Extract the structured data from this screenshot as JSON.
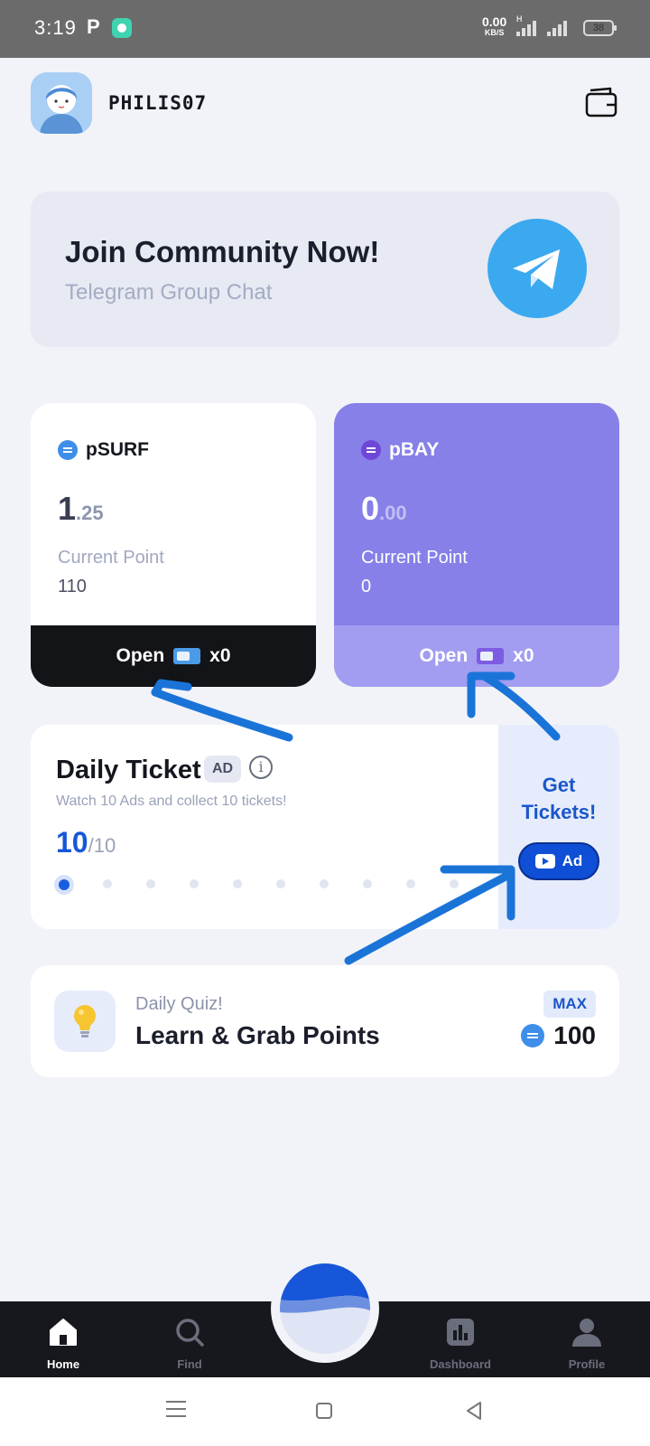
{
  "status_bar": {
    "time": "3:19",
    "notif_letter": "P",
    "net_speed": "0.00",
    "net_unit": "KB/S",
    "network_type": "H",
    "battery": "38"
  },
  "header": {
    "username": "PHILIS07",
    "avatar_icon": "user-avatar",
    "wallet_icon": "wallet-icon"
  },
  "community": {
    "title": "Join Community Now!",
    "subtitle": "Telegram Group Chat",
    "icon": "telegram-icon"
  },
  "cards": {
    "surf": {
      "token": "pSURF",
      "int_part": "1",
      "dec_part": ".25",
      "label": "Current Point",
      "value": "110",
      "open_label": "Open",
      "ticket_count": "x0",
      "color": "#3f8ee9"
    },
    "bay": {
      "token": "pBAY",
      "int_part": "0",
      "dec_part": ".00",
      "label": "Current Point",
      "value": "0",
      "open_label": "Open",
      "ticket_count": "x0",
      "color": "#7d5ce4"
    }
  },
  "daily_ticket": {
    "title": "Daily Ticket",
    "badge": "AD",
    "info": "i",
    "subtitle": "Watch 10 Ads and collect 10 tickets!",
    "count": "10",
    "total": "/10",
    "dots_total": 10,
    "dots_active": 1,
    "get_line1": "Get",
    "get_line2": "Tickets!",
    "ad_button": "Ad"
  },
  "quiz": {
    "kicker": "Daily Quiz!",
    "title": "Learn & Grab Points",
    "max_badge": "MAX",
    "points": "100",
    "icon": "lightbulb-icon"
  },
  "bottom_nav": {
    "items": [
      {
        "label": "Home",
        "icon": "home-icon",
        "active": true
      },
      {
        "label": "Find",
        "icon": "search-icon",
        "active": false
      },
      {
        "label": "Dashboard",
        "icon": "chart-icon",
        "active": false
      },
      {
        "label": "Profile",
        "icon": "user-icon",
        "active": false
      }
    ]
  },
  "colors": {
    "accent_blue": "#1657d8",
    "bay_purple": "#8680e8",
    "telegram": "#3ba9ef",
    "annotation_arrows": "#1a74d8"
  }
}
